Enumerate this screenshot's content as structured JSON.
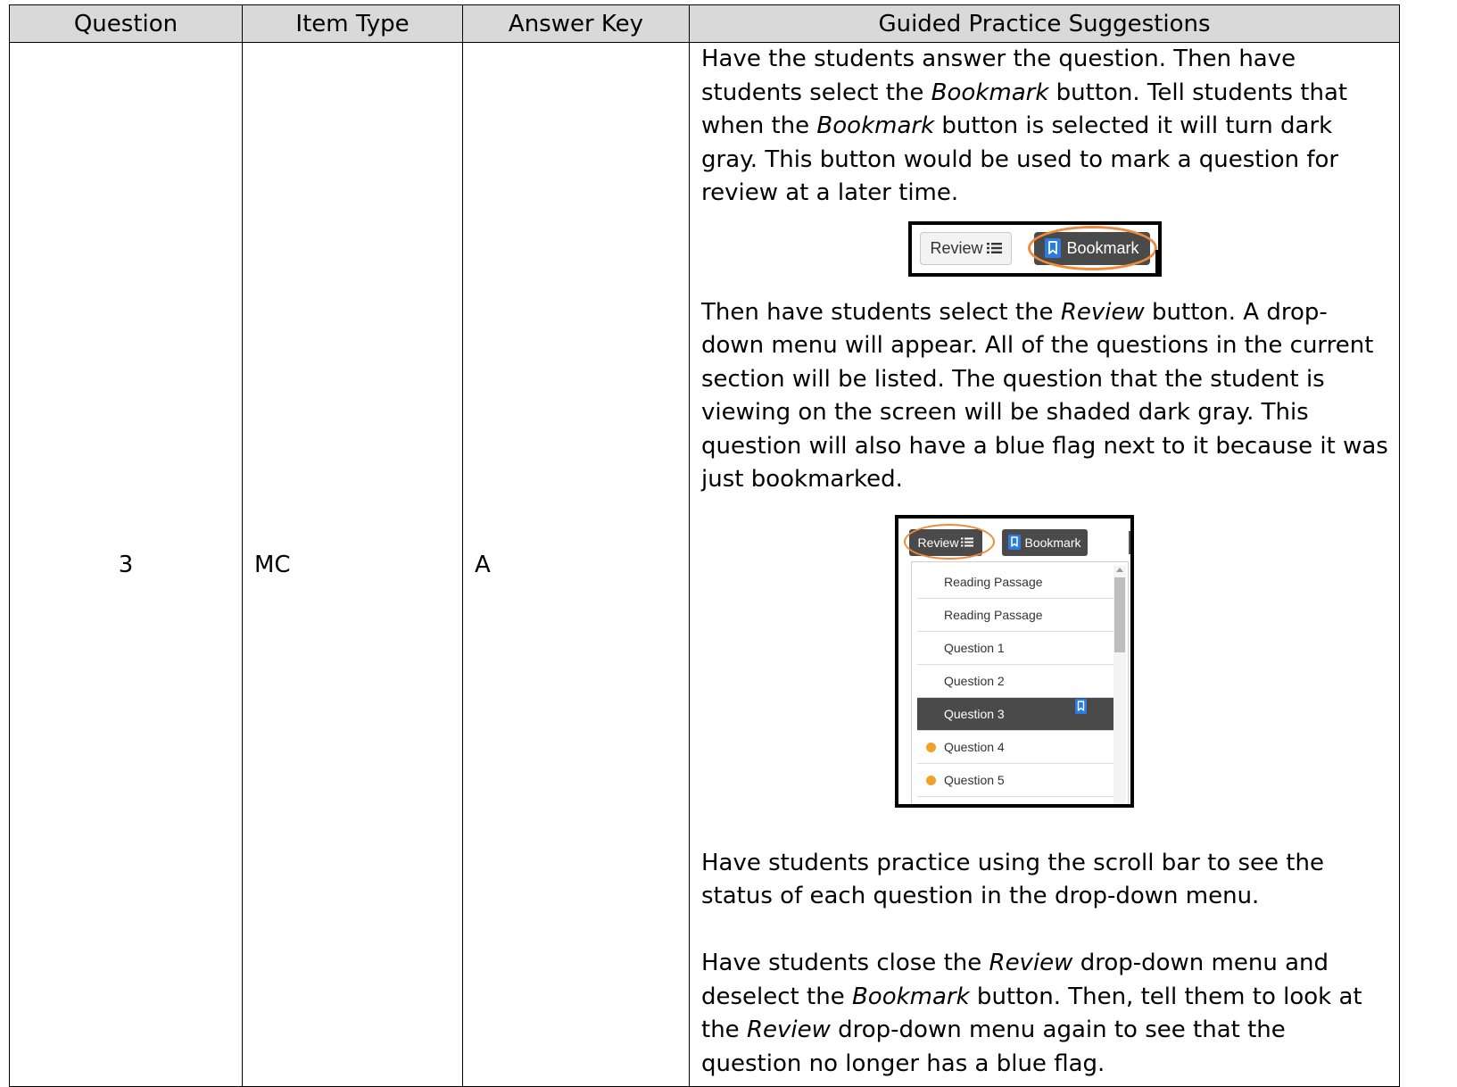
{
  "table": {
    "headers": [
      "Question",
      "Item Type",
      "Answer Key",
      "Guided Practice Suggestions"
    ],
    "row": {
      "question": "3",
      "item_type": "MC",
      "answer_key": "A"
    }
  },
  "guide": {
    "p1": [
      {
        "t": "Have the students answer the question.  Then have students select the "
      },
      {
        "t": "Bookmark",
        "i": true
      },
      {
        "t": " button.  Tell students that when the "
      },
      {
        "t": "Bookmark",
        "i": true
      },
      {
        "t": " button is selected it will turn dark gray. This button would be used to mark a question for review at a later time."
      }
    ],
    "p2": [
      {
        "t": "Then have students select the "
      },
      {
        "t": "Review",
        "i": true
      },
      {
        "t": " button. A drop-down menu will appear. All of the questions in the current section will be listed.  The question that the student is viewing on the screen will be shaded dark gray. This question will also have a blue flag next to it because it was just bookmarked."
      }
    ],
    "p3": [
      {
        "t": "Have students practice using the scroll bar to see the status of each question in the drop-down menu."
      }
    ],
    "p4": [
      {
        "t": "Have students close the "
      },
      {
        "t": "Review",
        "i": true
      },
      {
        "t": " drop-down menu and deselect the "
      },
      {
        "t": "Bookmark",
        "i": true
      },
      {
        "t": " button. Then, tell them to look at the "
      },
      {
        "t": "Review",
        "i": true
      },
      {
        "t": " drop-down menu again to see that the question no longer has a blue flag."
      }
    ]
  },
  "shot1": {
    "review_label": "Review",
    "bookmark_label": "Bookmark",
    "list_icon": "list-icon",
    "bookmark_icon": "bookmark-icon",
    "highlight_color": "#f08a3a"
  },
  "shot2": {
    "review_label": "Review",
    "bookmark_label": "Bookmark",
    "items": [
      {
        "label": "Reading Passage"
      },
      {
        "label": "Reading Passage"
      },
      {
        "label": "Question 1"
      },
      {
        "label": "Question 2"
      },
      {
        "label": "Question 3",
        "active": true,
        "flagged": true
      },
      {
        "label": "Question 4",
        "status": "orange-dot"
      },
      {
        "label": "Question 5",
        "status": "orange-dot"
      }
    ],
    "flag_color": "#2a7be4",
    "dot_color": "#f2a02c",
    "active_color": "#4a4a4a"
  }
}
